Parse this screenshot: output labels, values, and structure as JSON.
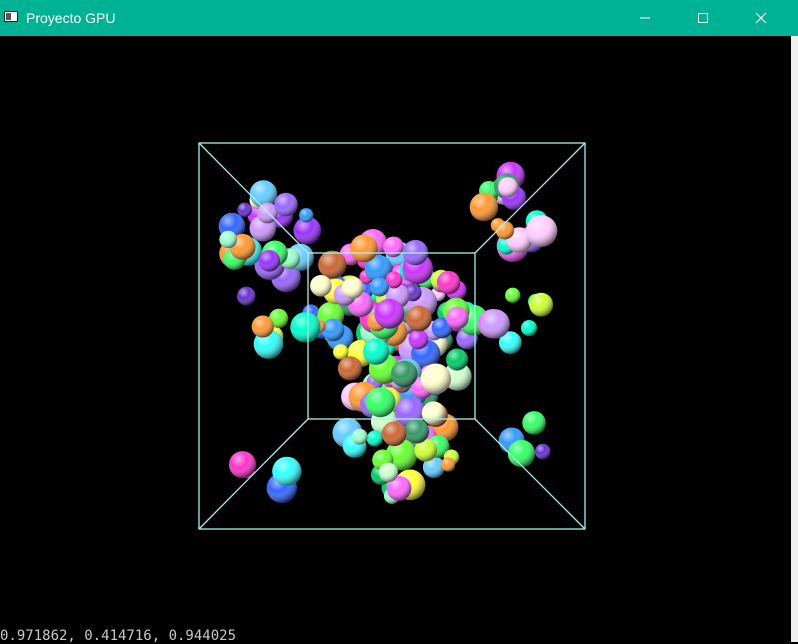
{
  "window": {
    "title": "Proyecto GPU",
    "titlebar_color": "#00b294",
    "icons": {
      "app": "app-window-icon",
      "minimize": "minimize-icon",
      "maximize": "maximize-icon",
      "close": "close-icon"
    }
  },
  "scene": {
    "background": "#000000",
    "box_edge_color": "#a8f0e8",
    "object": "cube wireframe with colored spheres"
  },
  "console": {
    "text": "0.971862, 0.414716, 0.944025"
  }
}
